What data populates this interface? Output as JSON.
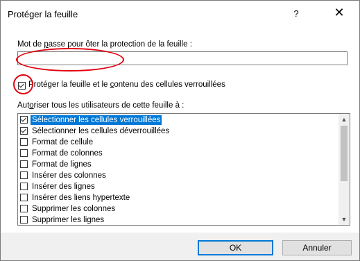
{
  "dialog": {
    "title": "Protéger la feuille",
    "help_label": "?",
    "close_label": "✕"
  },
  "password": {
    "label_pre": "Mot de ",
    "label_accel": "p",
    "label_post": "asse pour ôter la protection de la feuille :",
    "value": ""
  },
  "protect": {
    "checked": true,
    "label_pre": "Protéger la feuille et le ",
    "label_accel": "c",
    "label_post": "ontenu des cellules verrouillées"
  },
  "allow": {
    "label_pre": "Aut",
    "label_accel": "o",
    "label_post": "riser tous les utilisateurs de cette feuille à :"
  },
  "list": {
    "items": [
      {
        "label": "Sélectionner les cellules verrouillées",
        "checked": true,
        "selected": true
      },
      {
        "label": "Sélectionner les cellules déverrouillées",
        "checked": true,
        "selected": false
      },
      {
        "label": "Format de cellule",
        "checked": false,
        "selected": false
      },
      {
        "label": "Format de colonnes",
        "checked": false,
        "selected": false
      },
      {
        "label": "Format de lignes",
        "checked": false,
        "selected": false
      },
      {
        "label": "Insérer des colonnes",
        "checked": false,
        "selected": false
      },
      {
        "label": "Insérer des lignes",
        "checked": false,
        "selected": false
      },
      {
        "label": "Insérer des liens hypertexte",
        "checked": false,
        "selected": false
      },
      {
        "label": "Supprimer les colonnes",
        "checked": false,
        "selected": false
      },
      {
        "label": "Supprimer les lignes",
        "checked": false,
        "selected": false
      }
    ]
  },
  "buttons": {
    "ok": "OK",
    "cancel": "Annuler"
  },
  "colors": {
    "selection": "#0078d7",
    "annotation": "#e3000f"
  }
}
